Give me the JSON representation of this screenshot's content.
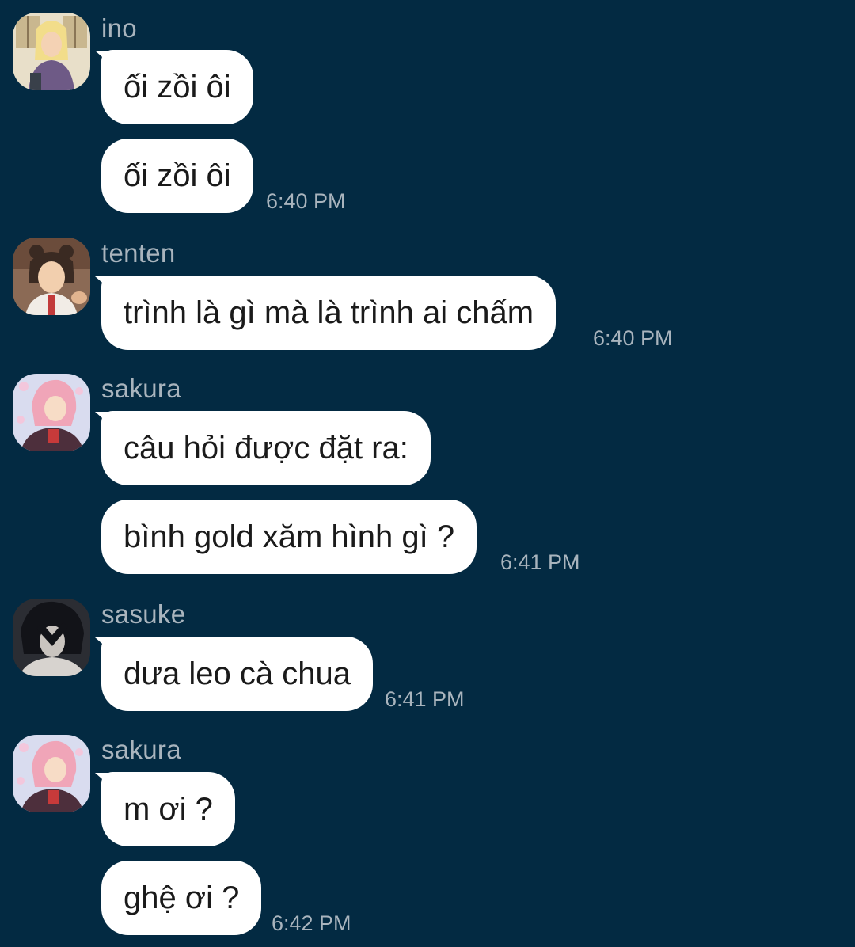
{
  "messages": [
    {
      "sender": "ino",
      "avatar_icon": "ino-avatar",
      "lines": [
        "ối zồi ôi",
        "ối zồi ôi"
      ],
      "time": "6:40 PM"
    },
    {
      "sender": "tenten",
      "avatar_icon": "tenten-avatar",
      "lines": [
        "trình là gì mà là trình ai chấm"
      ],
      "time": "6:40 PM"
    },
    {
      "sender": "sakura",
      "avatar_icon": "sakura-avatar",
      "lines": [
        "câu hỏi được đặt ra:",
        "bình gold xăm hình gì ?"
      ],
      "time": "6:41 PM"
    },
    {
      "sender": "sasuke",
      "avatar_icon": "sasuke-avatar",
      "lines": [
        "dưa leo cà chua"
      ],
      "time": "6:41 PM"
    },
    {
      "sender": "sakura",
      "avatar_icon": "sakura-avatar",
      "lines": [
        "m ơi ?",
        "ghệ ơi ?"
      ],
      "time": "6:42 PM"
    }
  ],
  "colors": {
    "background": "#032a42",
    "bubble": "#ffffff",
    "meta_text": "#a9b4bd"
  }
}
